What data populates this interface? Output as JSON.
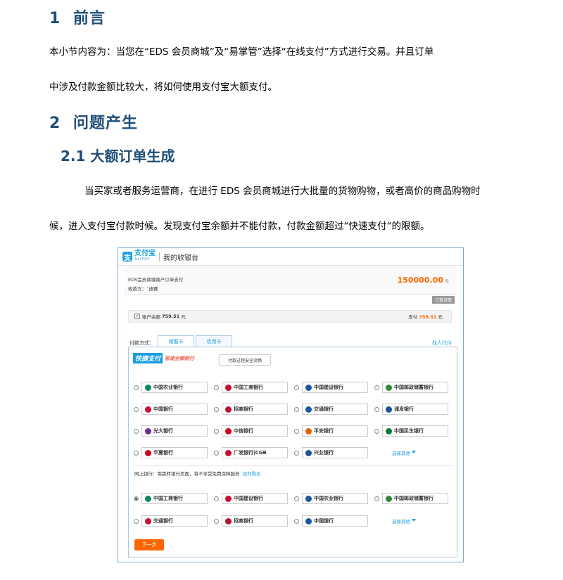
{
  "section1": {
    "num": "1",
    "title": "前言"
  },
  "para1": {
    "line1": "本小节内容为：当您在“EDS 会员商城”及“易掌管”选择“在线支付”方式进行交易。并且订单",
    "line2": "中涉及付款金额比较大，将如何使用支付宝大额支付。"
  },
  "section2": {
    "num": "2",
    "title": "问题产生"
  },
  "section21": {
    "title": "2.1 大额订单生成"
  },
  "para2": {
    "line1": "当买家或者服务运营商，在进行 EDS 会员商城进行大批量的货物购物，或者高价的商品购物时",
    "line2": "候，进入支付宝付款时候。发现支付宝余额并不能付款，付款金额超过“快速支付“的限额。"
  },
  "screenshot": {
    "logo_cn": "支付宝",
    "logo_en": "ALIPAY",
    "cashier": "我的收银台",
    "order_line1": "EDS会员商城商户订单支付",
    "order_line2": "收款方：“迪赛",
    "amount": "150000.00",
    "amount_unit": "元",
    "order_detail": "订单详情",
    "balance_label": "账户余额",
    "balance_value": "759.51",
    "balance_unit": "元",
    "pay_label": "支付",
    "pay_value": "759.51",
    "pay_unit": "元",
    "pay_method": "付款方式：",
    "tab_debit": "储蓄卡",
    "tab_credit": "信用卡",
    "agent_pay": "找人代付",
    "quick_label": "快捷支付",
    "quick_slogan": "极速全额赔付",
    "flow_button": "付款过程安全流畅",
    "quick_banks": [
      [
        "中国农业银行",
        "中国工商银行",
        "中国建设银行",
        "中国邮政储蓄银行"
      ],
      [
        "中国银行",
        "招商银行",
        "交通银行",
        "浦发银行"
      ],
      [
        "光大银行",
        "中信银行",
        "平安银行",
        "中国民生银行"
      ],
      [
        "华夏银行",
        "广发银行|CGB",
        "兴业银行"
      ]
    ],
    "more1": "选择其他",
    "netbank_label": "网上银行：需跳转银行页面，将不享受免费保障服务",
    "netbank_link": "如何购买",
    "net_banks": [
      [
        "中国工商银行",
        "中国建设银行",
        "中国农业银行",
        "中国邮政储蓄银行"
      ],
      [
        "交通银行",
        "招商银行",
        "中国银行"
      ]
    ],
    "more2": "选择其他",
    "next": "下一步"
  }
}
